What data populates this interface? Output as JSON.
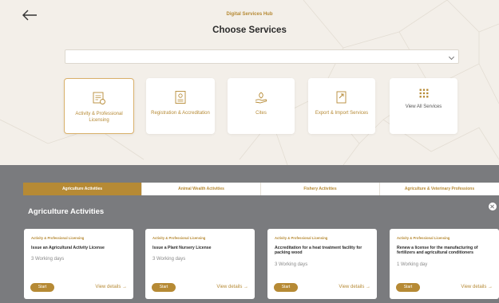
{
  "header": {
    "hub_title": "Digital Services Hub",
    "page_title": "Choose Services"
  },
  "search": {
    "value": "",
    "placeholder": ""
  },
  "services": [
    {
      "label": "Activity & Professional Licensing",
      "icon": "license-document-icon",
      "active": true
    },
    {
      "label": "Registration & Accreditation",
      "icon": "certificate-icon",
      "active": false
    },
    {
      "label": "Cites",
      "icon": "hand-leaf-icon",
      "active": false
    },
    {
      "label": "Export & Import Services",
      "icon": "export-document-icon",
      "active": false
    },
    {
      "label": "View All Services",
      "icon": "grid-icon",
      "active": false
    }
  ],
  "tabs": [
    {
      "label": "Agriculture Activities",
      "active": true
    },
    {
      "label": "Animal Wealth Activities",
      "active": false
    },
    {
      "label": "Fishery Activities",
      "active": false
    },
    {
      "label": "Agriculture & Veterinary Professions",
      "active": false
    }
  ],
  "section_title": "Agriculture Activities",
  "activities": [
    {
      "category": "Activity & Professional Licensing",
      "name": "Issue an Agricultural Activity License",
      "duration": "3 Working days",
      "start": "Start",
      "view": "View details →"
    },
    {
      "category": "Activity & Professional Licensing",
      "name": "Issue a Plant Nursery License",
      "duration": "3 Working days",
      "start": "Start",
      "view": "View details →"
    },
    {
      "category": "Activity & Professional Licensing",
      "name": "Accreditation for a heat treatment facility for packing wood",
      "duration": "3 Working days",
      "start": "Start",
      "view": "View details →"
    },
    {
      "category": "Activity & Professional Licensing",
      "name": "Renew a license for the manufacturing of fertilizers and agricultural conditioners",
      "duration": "1 Working day",
      "start": "Start",
      "view": "View details →"
    }
  ],
  "colors": {
    "accent": "#b68a35",
    "overlay": "#7a7b7e",
    "background": "#f3efe9"
  }
}
